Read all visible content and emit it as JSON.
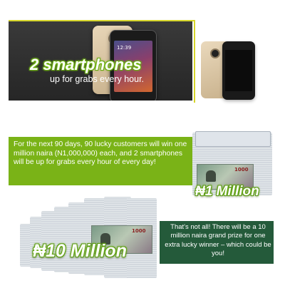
{
  "banner": {
    "headline": "2 smartphones",
    "subhead": "up for grabs every hour.",
    "phone_clock": "12:39"
  },
  "promo_box": {
    "text": "For the next 90 days, 90 lucky customers will win one million naira (N1,000,000) each, and 2 smartphones will be up for grabs every hour of every day!",
    "color": "#7ab317"
  },
  "prize_small": {
    "label": "₦1 Million",
    "note_denomination": "1000"
  },
  "grand_prize_box": {
    "text": "That's not all! There will be a 10 million naira grand prize for one extra lucky winner – which could be you!",
    "color": "#245a3a"
  },
  "prize_large": {
    "label": "₦10 Million",
    "note_denomination": "1000"
  },
  "colors": {
    "accent_green": "#7ab317",
    "dark_green": "#245a3a",
    "banner_border": "#d6d52a"
  }
}
